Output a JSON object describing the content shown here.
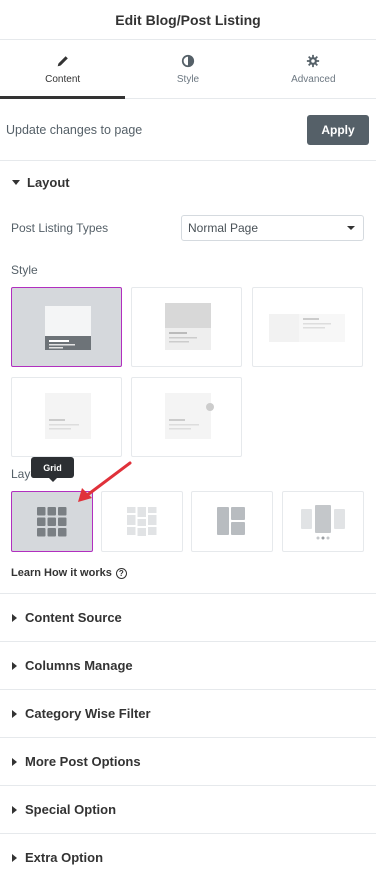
{
  "header": {
    "title": "Edit Blog/Post Listing"
  },
  "tabs": [
    {
      "label": "Content",
      "icon": "pencil-icon",
      "active": true
    },
    {
      "label": "Style",
      "icon": "half-circle-icon",
      "active": false
    },
    {
      "label": "Advanced",
      "icon": "gear-icon",
      "active": false
    }
  ],
  "update": {
    "label": "Update changes to page",
    "apply_label": "Apply"
  },
  "layout_section": {
    "title": "Layout",
    "post_listing_types": {
      "label": "Post Listing Types",
      "value": "Normal Page"
    },
    "style_label": "Style",
    "layout_label": "Layout",
    "tooltip": "Grid",
    "learn_label": "Learn How it works",
    "help_glyph": "?"
  },
  "sections": [
    {
      "label": "Content Source"
    },
    {
      "label": "Columns Manage"
    },
    {
      "label": "Category Wise Filter"
    },
    {
      "label": "More Post Options"
    },
    {
      "label": "Special Option"
    },
    {
      "label": "Extra Option"
    }
  ],
  "colors": {
    "accent": "#b12fbf",
    "apply_bg": "#556068",
    "arrow": "#e0313a",
    "tooltip_bg": "#2c2f33"
  }
}
